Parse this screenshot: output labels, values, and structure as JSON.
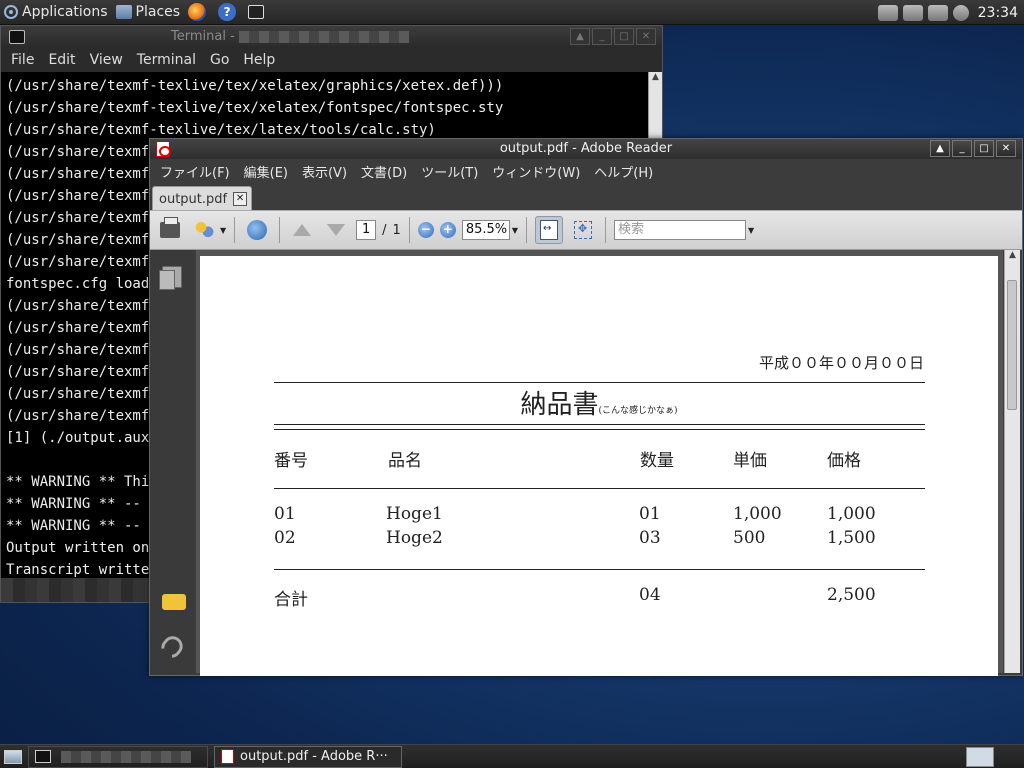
{
  "top_panel": {
    "applications": "Applications",
    "places": "Places",
    "clock": "23:34"
  },
  "terminal": {
    "title": "Terminal -",
    "menu": [
      "File",
      "Edit",
      "View",
      "Terminal",
      "Go",
      "Help"
    ],
    "lines": [
      "(/usr/share/texmf-texlive/tex/xelatex/graphics/xetex.def)))",
      "(/usr/share/texmf-texlive/tex/xelatex/fontspec/fontspec.sty",
      "(/usr/share/texmf-texlive/tex/latex/tools/calc.sty)",
      "(/usr/share/texmf-",
      "(/usr/share/texmf-",
      "(/usr/share/texmf/",
      "(/usr/share/texmf-",
      "(/usr/share/texmf-",
      "(/usr/share/texmf-",
      "fontspec.cfg loade",
      "(/usr/share/texmf-",
      "(/usr/share/texmf-",
      "(/usr/share/texmf-",
      "(/usr/share/texmf-",
      "(/usr/share/texmf-",
      "(/usr/share/texmf-",
      "[1] (./output.aux)",
      "",
      "** WARNING ** This",
      "** WARNING ** -- C",
      "** WARNING ** -- R",
      "Output written on ",
      "Transcript written"
    ]
  },
  "reader": {
    "title": "output.pdf - Adobe Reader",
    "menu": [
      "ファイル(F)",
      "編集(E)",
      "表示(V)",
      "文書(D)",
      "ツール(T)",
      "ウィンドウ(W)",
      "ヘルプ(H)"
    ],
    "tab_label": "output.pdf",
    "page_current": "1",
    "page_sep": "/",
    "page_total": "1",
    "zoom": "85.5%",
    "search_placeholder": "検索"
  },
  "document": {
    "date": "平成００年００月００日",
    "title": "納品書",
    "title_note": "(こんな感じかなぁ)",
    "headers": [
      "番号",
      "品名",
      "数量",
      "単価",
      "価格"
    ],
    "rows": [
      [
        "01",
        "Hoge1",
        "01",
        "1,000",
        "1,000"
      ],
      [
        "02",
        "Hoge2",
        "03",
        "500",
        "1,500"
      ]
    ],
    "total": {
      "label": "合計",
      "qty": "04",
      "price": "2,500"
    }
  },
  "bottom_panel": {
    "reader_task": "output.pdf - Adobe R···"
  },
  "colors": {
    "desktop": "#163a6e",
    "terminal_bg": "#000000",
    "reader_chrome": "#3c3c3c",
    "pdf_icon_red": "#cc0000"
  }
}
